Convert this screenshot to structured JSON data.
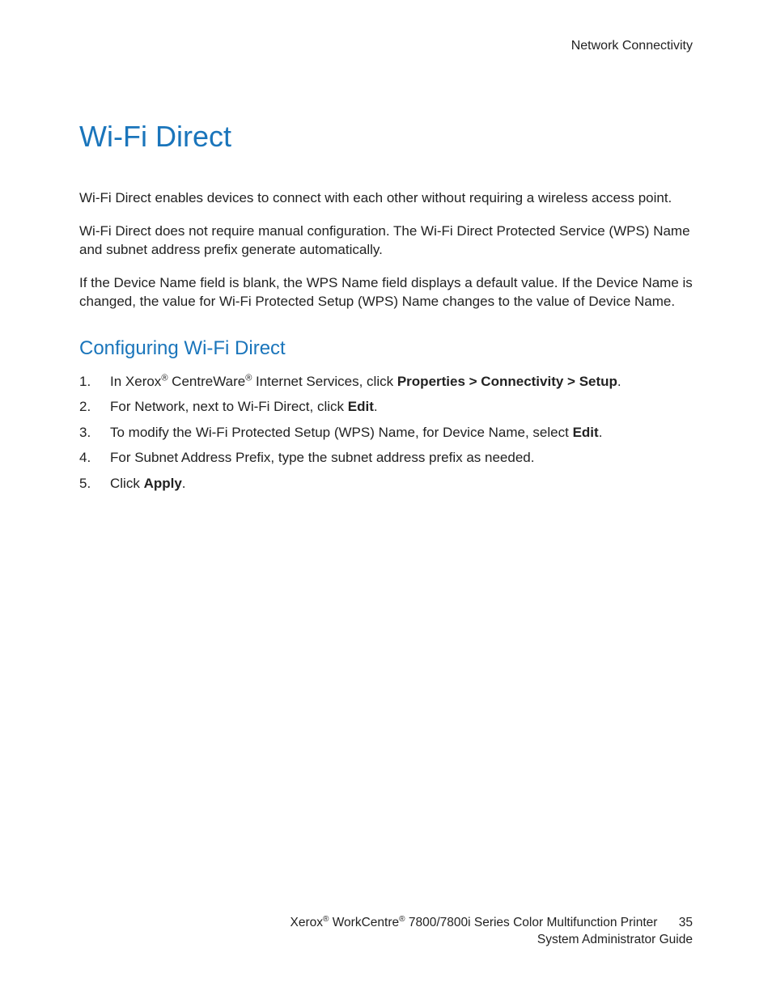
{
  "header": {
    "chapter": "Network Connectivity"
  },
  "title": "Wi-Fi Direct",
  "paragraphs": {
    "p1": "Wi-Fi Direct enables devices to connect with each other without requiring a wireless access point.",
    "p2": "Wi-Fi Direct does not require manual configuration. The Wi-Fi Direct Protected Service (WPS) Name and subnet address prefix generate automatically.",
    "p3": "If the Device Name field is blank, the WPS Name field displays a default value. If the Device Name is changed, the value for Wi-Fi Protected Setup (WPS) Name changes to the value of Device Name."
  },
  "section": {
    "heading": "Configuring Wi-Fi Direct",
    "steps": {
      "s1a": "In Xerox",
      "s1b": " CentreWare",
      "s1c": " Internet Services, click ",
      "s1d": "Properties > Connectivity > Setup",
      "s1e": ".",
      "s2a": "For Network, next to Wi-Fi Direct, click ",
      "s2b": "Edit",
      "s2c": ".",
      "s3a": "To modify the Wi-Fi Protected Setup (WPS) Name, for Device Name, select ",
      "s3b": "Edit",
      "s3c": ".",
      "s4": "For Subnet Address Prefix, type the subnet address prefix as needed.",
      "s5a": "Click ",
      "s5b": "Apply",
      "s5c": "."
    }
  },
  "footer": {
    "brand1": "Xerox",
    "brand2": " WorkCentre",
    "rest1": " 7800/7800i Series Color Multifunction Printer",
    "page": "35",
    "line2": "System Administrator Guide"
  },
  "reg": "®"
}
